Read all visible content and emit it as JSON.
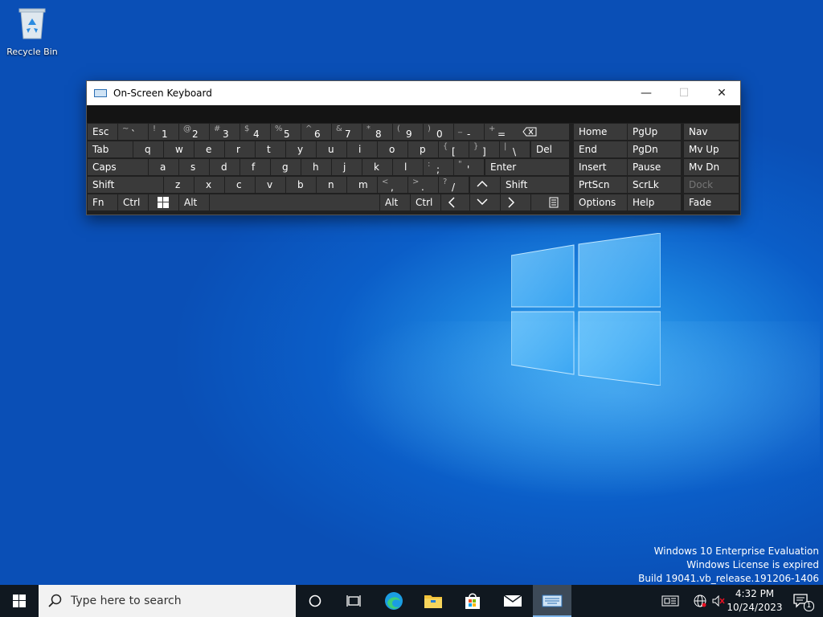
{
  "desktop": {
    "recycle_bin_label": "Recycle Bin",
    "watermark": {
      "line1": "Windows 10 Enterprise Evaluation",
      "line2": "Windows License is expired",
      "line3": "Build 19041.vb_release.191206-1406"
    }
  },
  "osk": {
    "title": "On-Screen Keyboard",
    "controls": {
      "minimize": "—",
      "maximize": "☐",
      "close": "✕"
    },
    "keys": {
      "esc": "Esc",
      "tab": "Tab",
      "caps": "Caps",
      "shift_l": "Shift",
      "fn": "Fn",
      "ctrl_l": "Ctrl",
      "alt_l": "Alt",
      "alt_r": "Alt",
      "ctrl_r": "Ctrl",
      "del": "Del",
      "enter": "Enter",
      "shift_r": "Shift",
      "home": "Home",
      "pgup": "PgUp",
      "nav": "Nav",
      "end": "End",
      "pgdn": "PgDn",
      "mvup": "Mv Up",
      "insert": "Insert",
      "pause": "Pause",
      "mvdn": "Mv Dn",
      "prtscn": "PrtScn",
      "scrlk": "ScrLk",
      "dock": "Dock",
      "options": "Options",
      "help": "Help",
      "fade": "Fade",
      "row1": [
        {
          "s": "~",
          "m": "`"
        },
        {
          "s": "!",
          "m": "1"
        },
        {
          "s": "@",
          "m": "2"
        },
        {
          "s": "#",
          "m": "3"
        },
        {
          "s": "$",
          "m": "4"
        },
        {
          "s": "%",
          "m": "5"
        },
        {
          "s": "^",
          "m": "6"
        },
        {
          "s": "&",
          "m": "7"
        },
        {
          "s": "*",
          "m": "8"
        },
        {
          "s": "(",
          "m": "9"
        },
        {
          "s": ")",
          "m": "0"
        },
        {
          "s": "_",
          "m": "-"
        },
        {
          "s": "+",
          "m": "="
        }
      ],
      "row2": [
        "q",
        "w",
        "e",
        "r",
        "t",
        "y",
        "u",
        "i",
        "o",
        "p"
      ],
      "row2_sym": [
        {
          "s": "{",
          "m": "["
        },
        {
          "s": "}",
          "m": "]"
        },
        {
          "s": "|",
          "m": "\\"
        }
      ],
      "row3": [
        "a",
        "s",
        "d",
        "f",
        "g",
        "h",
        "j",
        "k",
        "l"
      ],
      "row3_sym": [
        {
          "s": ":",
          "m": ";"
        },
        {
          "s": "\"",
          "m": "'"
        }
      ],
      "row4": [
        "z",
        "x",
        "c",
        "v",
        "b",
        "n",
        "m"
      ],
      "row4_sym": [
        {
          "s": "<",
          "m": ","
        },
        {
          "s": ">",
          "m": "."
        },
        {
          "s": "?",
          "m": "/"
        }
      ]
    }
  },
  "taskbar": {
    "search_placeholder": "Type here to search",
    "clock_time": "4:32 PM",
    "clock_date": "10/24/2023",
    "notification_count": "1"
  }
}
